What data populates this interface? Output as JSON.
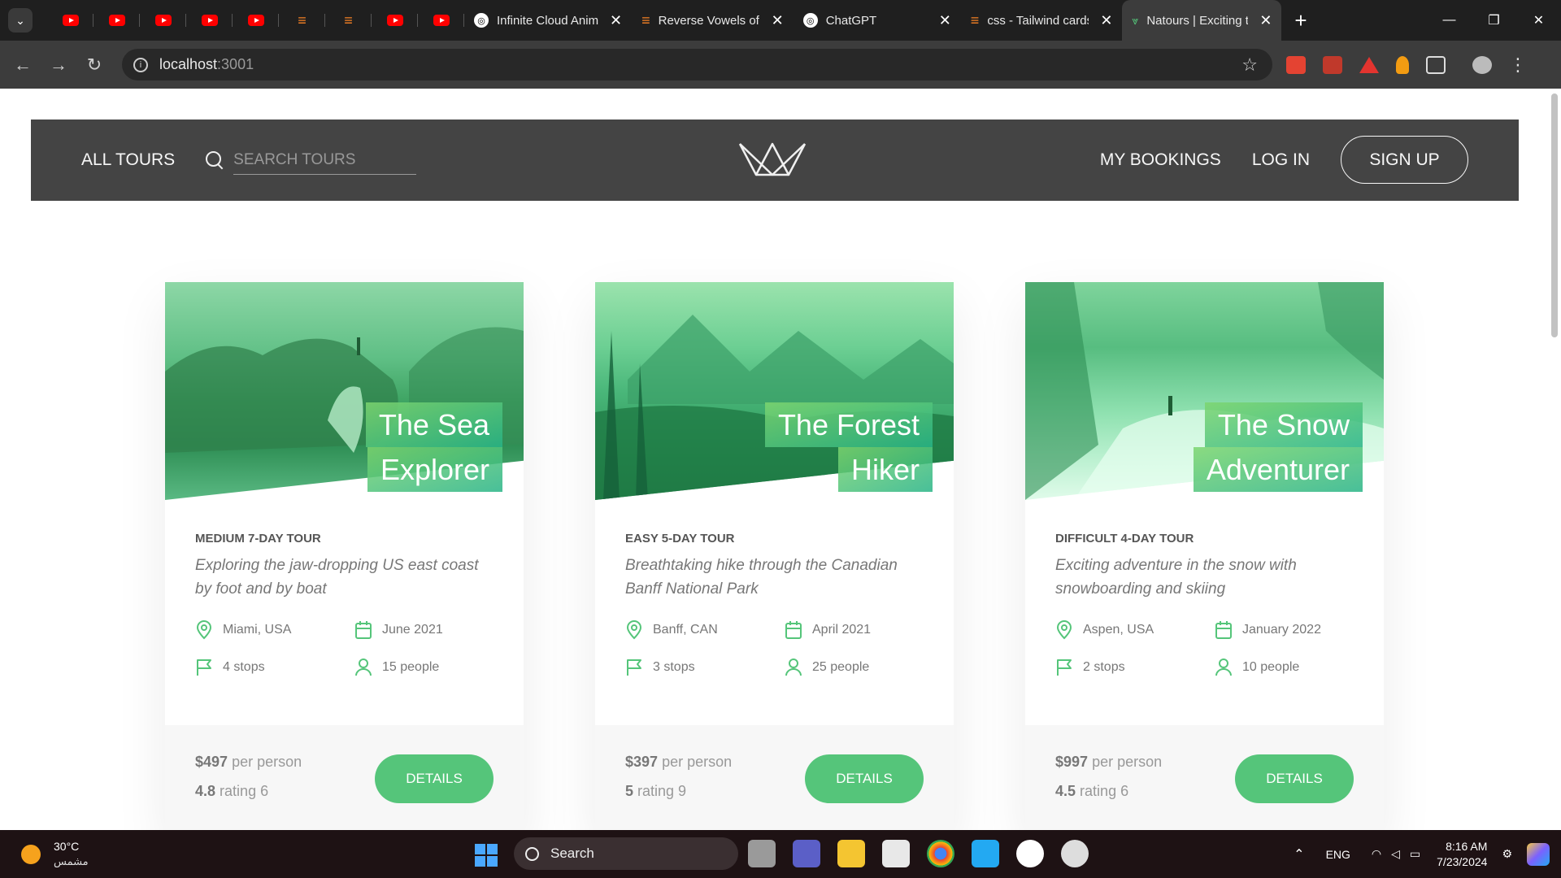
{
  "browser": {
    "tabs": [
      {
        "title": "Infinite Cloud Anim",
        "icon": "chatgpt-icon"
      },
      {
        "title": "Reverse Vowels of a",
        "icon": "stackoverflow-icon"
      },
      {
        "title": "ChatGPT",
        "icon": "chatgpt-icon"
      },
      {
        "title": "css - Tailwind cards",
        "icon": "stackoverflow-icon"
      },
      {
        "title": "Natours | Exciting t",
        "icon": "natours-icon",
        "active": true
      }
    ],
    "url_host": "localhost",
    "url_port": ":3001"
  },
  "header": {
    "all_tours": "All tours",
    "search_placeholder": "Search tours",
    "my_bookings": "My bookings",
    "log_in": "Log in",
    "sign_up": "Sign up"
  },
  "tours": [
    {
      "title_line1": "The Sea",
      "title_line2": "Explorer",
      "subheading": "Medium 7-day tour",
      "summary": "Exploring the jaw-dropping US east coast by foot and by boat",
      "location": "Miami, USA",
      "date": "June 2021",
      "stops": "4 stops",
      "people": "15 people",
      "price": "$497",
      "price_suffix": "per person",
      "rating": "4.8",
      "rating_suffix": "rating 6",
      "button": "Details"
    },
    {
      "title_line1": "The Forest",
      "title_line2": "Hiker",
      "subheading": "Easy 5-day tour",
      "summary": "Breathtaking hike through the Canadian Banff National Park",
      "location": "Banff, CAN",
      "date": "April 2021",
      "stops": "3 stops",
      "people": "25 people",
      "price": "$397",
      "price_suffix": "per person",
      "rating": "5",
      "rating_suffix": "rating 9",
      "button": "Details"
    },
    {
      "title_line1": "The Snow",
      "title_line2": "Adventurer",
      "subheading": "Difficult 4-day tour",
      "summary": "Exciting adventure in the snow with snowboarding and skiing",
      "location": "Aspen, USA",
      "date": "January 2022",
      "stops": "2 stops",
      "people": "10 people",
      "price": "$997",
      "price_suffix": "per person",
      "rating": "4.5",
      "rating_suffix": "rating 6",
      "button": "Details"
    }
  ],
  "taskbar": {
    "temperature": "30°C",
    "condition": "مشمس",
    "search_label": "Search",
    "language": "ENG",
    "time": "8:16 AM",
    "date": "7/23/2024"
  },
  "colors": {
    "accent": "#55c57a",
    "header_bg": "#444444",
    "text_muted": "#777777"
  }
}
